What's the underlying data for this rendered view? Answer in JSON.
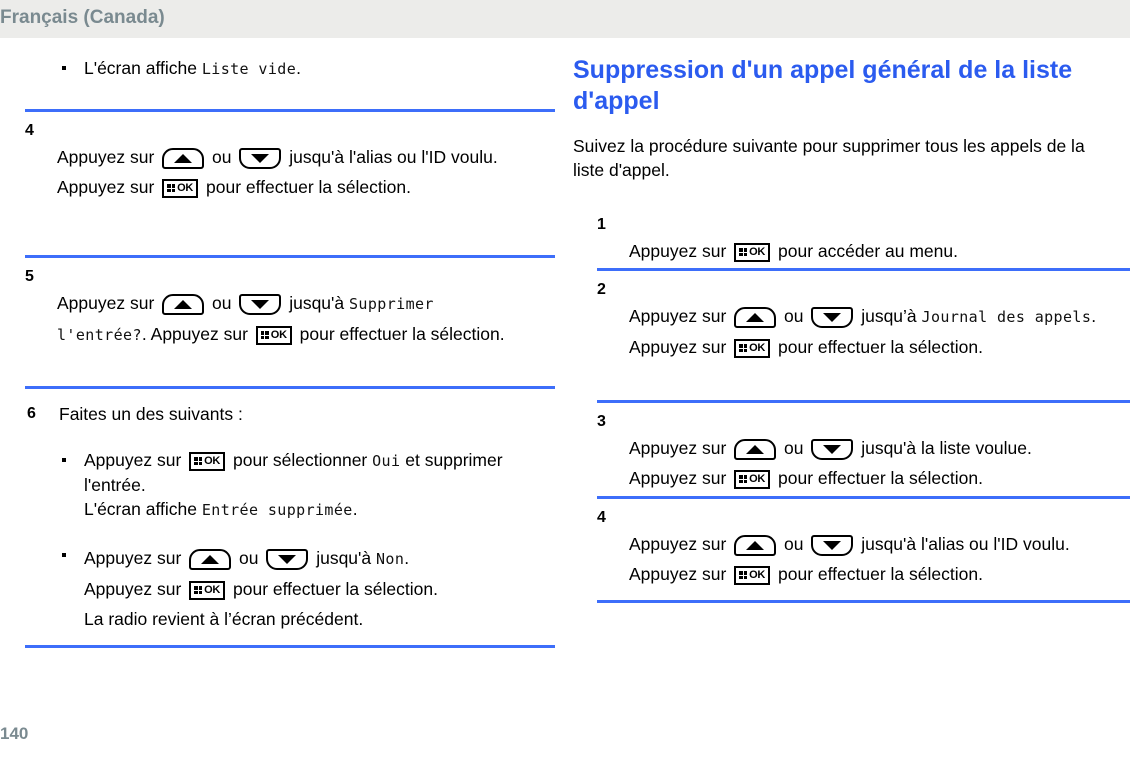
{
  "header": {
    "running_title": "Français (Canada)"
  },
  "footer": {
    "page_number": "140"
  },
  "colors": {
    "heading_blue": "#2B5BEF",
    "rule_blue": "#3D6EFA",
    "header_bg": "#ECECEA",
    "header_text": "#7A8A90",
    "body_text": "#000000"
  },
  "icons": {
    "up_key": "arrow-up-key-icon",
    "down_key": "arrow-down-key-icon",
    "ok_key": "menu-ok-key-icon"
  },
  "left_column": {
    "trailing_bullet": {
      "prefix": "L'écran affiche ",
      "mono": "Liste vide",
      "suffix": "."
    },
    "steps": [
      {
        "number": "4",
        "parts": [
          {
            "t": "text",
            "v": "Appuyez sur "
          },
          {
            "t": "key",
            "v": "up"
          },
          {
            "t": "text",
            "v": " ou "
          },
          {
            "t": "key",
            "v": "down"
          },
          {
            "t": "text",
            "v": " jusqu'à l'alias ou l'ID voulu. Appuyez sur "
          },
          {
            "t": "key",
            "v": "ok"
          },
          {
            "t": "text",
            "v": " pour effectuer la sélection."
          }
        ]
      },
      {
        "number": "5",
        "parts": [
          {
            "t": "text",
            "v": "Appuyez sur "
          },
          {
            "t": "key",
            "v": "up"
          },
          {
            "t": "text",
            "v": " ou "
          },
          {
            "t": "key",
            "v": "down"
          },
          {
            "t": "text",
            "v": " jusqu'à "
          },
          {
            "t": "mono",
            "v": "Supprimer l'entrée?"
          },
          {
            "t": "text",
            "v": ". Appuyez sur "
          },
          {
            "t": "key",
            "v": "ok"
          },
          {
            "t": "text",
            "v": " pour effectuer la sélection."
          }
        ]
      }
    ],
    "step6": {
      "number": "6",
      "lead": "Faites un des suivants :",
      "bullets": [
        {
          "parts": [
            {
              "t": "text",
              "v": "Appuyez sur "
            },
            {
              "t": "key",
              "v": "ok"
            },
            {
              "t": "text",
              "v": " pour sélectionner "
            },
            {
              "t": "mono",
              "v": "Oui"
            },
            {
              "t": "text",
              "v": " et supprimer l'entrée."
            },
            {
              "t": "br"
            },
            {
              "t": "text",
              "v": "L'écran affiche "
            },
            {
              "t": "mono",
              "v": "Entrée supprimée"
            },
            {
              "t": "text",
              "v": "."
            }
          ]
        },
        {
          "parts": [
            {
              "t": "text",
              "v": "Appuyez sur "
            },
            {
              "t": "key",
              "v": "up"
            },
            {
              "t": "text",
              "v": " ou "
            },
            {
              "t": "key",
              "v": "down"
            },
            {
              "t": "text",
              "v": " jusqu'à "
            },
            {
              "t": "mono",
              "v": "Non"
            },
            {
              "t": "text",
              "v": "."
            },
            {
              "t": "br"
            },
            {
              "t": "text",
              "v": "Appuyez sur "
            },
            {
              "t": "key",
              "v": "ok"
            },
            {
              "t": "text",
              "v": " pour effectuer la sélection."
            },
            {
              "t": "br"
            },
            {
              "t": "text",
              "v": "La radio revient à l’écran précédent."
            }
          ]
        }
      ]
    }
  },
  "right_column": {
    "heading": "Suppression d'un appel général de la liste d'appel",
    "intro": "Suivez la procédure suivante pour supprimer tous les appels de la liste d'appel.",
    "steps": [
      {
        "number": "1",
        "parts": [
          {
            "t": "text",
            "v": "Appuyez sur "
          },
          {
            "t": "key",
            "v": "ok"
          },
          {
            "t": "text",
            "v": " pour accéder au menu."
          }
        ]
      },
      {
        "number": "2",
        "parts": [
          {
            "t": "text",
            "v": "Appuyez sur "
          },
          {
            "t": "key",
            "v": "up"
          },
          {
            "t": "text",
            "v": " ou "
          },
          {
            "t": "key",
            "v": "down"
          },
          {
            "t": "text",
            "v": " jusqu’à "
          },
          {
            "t": "mono",
            "v": "Journal des appels"
          },
          {
            "t": "text",
            "v": ". Appuyez sur "
          },
          {
            "t": "key",
            "v": "ok"
          },
          {
            "t": "text",
            "v": " pour effectuer la sélection."
          }
        ]
      },
      {
        "number": "3",
        "parts": [
          {
            "t": "text",
            "v": "Appuyez sur "
          },
          {
            "t": "key",
            "v": "up"
          },
          {
            "t": "text",
            "v": " ou "
          },
          {
            "t": "key",
            "v": "down"
          },
          {
            "t": "text",
            "v": " jusqu'à la liste voulue. Appuyez sur "
          },
          {
            "t": "key",
            "v": "ok"
          },
          {
            "t": "text",
            "v": " pour effectuer la sélection."
          }
        ]
      },
      {
        "number": "4",
        "parts": [
          {
            "t": "text",
            "v": "Appuyez sur "
          },
          {
            "t": "key",
            "v": "up"
          },
          {
            "t": "text",
            "v": " ou "
          },
          {
            "t": "key",
            "v": "down"
          },
          {
            "t": "text",
            "v": " jusqu'à l'alias ou l'ID voulu. Appuyez sur "
          },
          {
            "t": "key",
            "v": "ok"
          },
          {
            "t": "text",
            "v": " pour effectuer la sélection."
          }
        ]
      }
    ]
  }
}
